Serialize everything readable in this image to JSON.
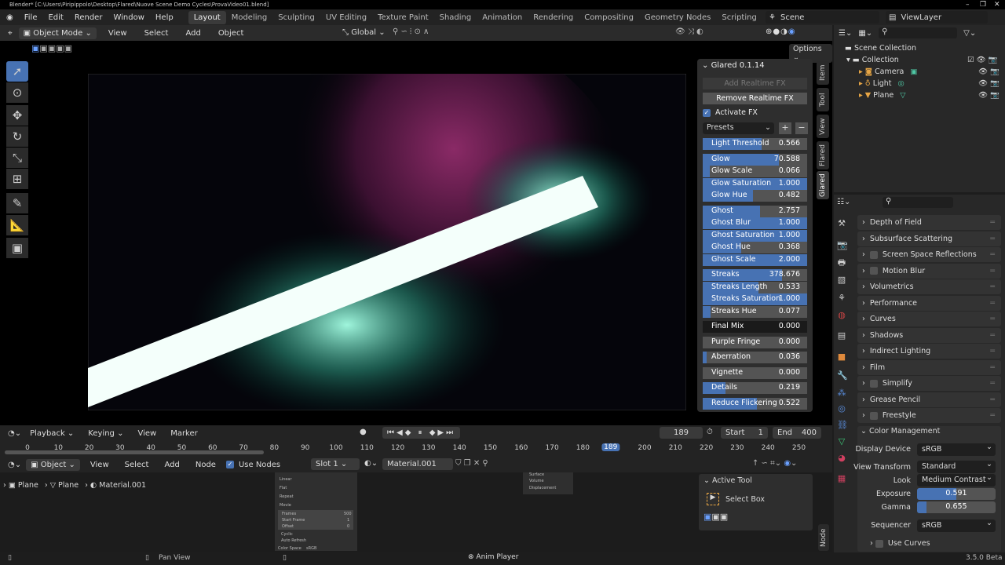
{
  "window": {
    "title": "Blender* [C:\\Users\\Piripippolo\\Desktop\\Flared\\Nuove Scene Demo Cycles\\ProvaVideo01.blend]",
    "controls": [
      "–",
      "❐",
      "✕"
    ]
  },
  "menu": [
    "File",
    "Edit",
    "Render",
    "Window",
    "Help"
  ],
  "workspaces": [
    {
      "label": "Layout",
      "active": true
    },
    {
      "label": "Modeling"
    },
    {
      "label": "Sculpting"
    },
    {
      "label": "UV Editing"
    },
    {
      "label": "Texture Paint"
    },
    {
      "label": "Shading"
    },
    {
      "label": "Animation"
    },
    {
      "label": "Rendering"
    },
    {
      "label": "Compositing"
    },
    {
      "label": "Geometry Nodes"
    },
    {
      "label": "Scripting"
    }
  ],
  "add_workspace": "+",
  "scene": {
    "label": "Scene",
    "view_layer": "ViewLayer"
  },
  "viewport_header": {
    "mode": "Object Mode",
    "menus": [
      "View",
      "Select",
      "Add",
      "Object"
    ],
    "orientation": "Global",
    "options": "Options"
  },
  "toolbar": {
    "icons": [
      "select-box-icon",
      "cursor-icon",
      "move-icon",
      "rotate-icon",
      "scale-icon",
      "transform-icon",
      "annotate-icon",
      "measure-icon",
      "add-cube-icon"
    ],
    "glyphs": [
      "➚",
      "⊙",
      "✥",
      "↻",
      "⤡",
      "⊞",
      "✎",
      "📐",
      "▣"
    ]
  },
  "glared": {
    "title": "Glared 0.1.14",
    "add_fx": "Add Realtime FX",
    "remove_fx": "Remove Realtime FX",
    "activate_fx": "Activate FX",
    "activate_checked": true,
    "presets": "Presets",
    "preset_add": "+",
    "preset_remove": "−",
    "sliders": [
      {
        "label": "Light Threshold",
        "value": "0.566",
        "fill": 0.566,
        "group": 0
      },
      {
        "label": "Glow",
        "value": "70.588",
        "fill": 0.73,
        "group": 1
      },
      {
        "label": "Glow Scale",
        "value": "0.066",
        "fill": 0.066,
        "group": 1
      },
      {
        "label": "Glow Saturation",
        "value": "1.000",
        "fill": 1,
        "group": 1
      },
      {
        "label": "Glow Hue",
        "value": "0.482",
        "fill": 0.482,
        "group": 1
      },
      {
        "label": "Ghost",
        "value": "2.757",
        "fill": 0.55,
        "group": 2
      },
      {
        "label": "Ghost Blur",
        "value": "1.000",
        "fill": 1,
        "group": 2
      },
      {
        "label": "Ghost Saturation",
        "value": "1.000",
        "fill": 1,
        "group": 2
      },
      {
        "label": "Ghost Hue",
        "value": "0.368",
        "fill": 0.368,
        "group": 2
      },
      {
        "label": "Ghost Scale",
        "value": "2.000",
        "fill": 1,
        "group": 2
      },
      {
        "label": "Streaks",
        "value": "378.676",
        "fill": 0.757,
        "group": 3
      },
      {
        "label": "Streaks Length",
        "value": "0.533",
        "fill": 0.533,
        "group": 3
      },
      {
        "label": "Streaks Saturation",
        "value": "1.000",
        "fill": 1,
        "group": 3
      },
      {
        "label": "Streaks Hue",
        "value": "0.077",
        "fill": 0.077,
        "group": 3
      },
      {
        "label": "Final Mix",
        "value": "0.000",
        "fill": 0,
        "group": 4,
        "dark": true
      },
      {
        "label": "Purple Fringe",
        "value": "0.000",
        "fill": 0,
        "group": 5
      },
      {
        "label": "Aberration",
        "value": "0.036",
        "fill": 0.036,
        "group": 6
      },
      {
        "label": "Vignette",
        "value": "0.000",
        "fill": 0,
        "group": 7
      },
      {
        "label": "Details",
        "value": "0.219",
        "fill": 0.219,
        "group": 8
      },
      {
        "label": "Reduce Flickering",
        "value": "0.522",
        "fill": 0.522,
        "group": 9
      }
    ],
    "tabs": [
      "Item",
      "Tool",
      "View",
      "Flared",
      "Glared"
    ]
  },
  "outliner": {
    "root": "Scene Collection",
    "collection": "Collection",
    "objects": [
      "Camera",
      "Light",
      "Plane"
    ]
  },
  "properties": {
    "panels": [
      {
        "label": "Depth of Field"
      },
      {
        "label": "Subsurface Scattering"
      },
      {
        "label": "Screen Space Reflections",
        "checkbox": true
      },
      {
        "label": "Motion Blur",
        "checkbox": true
      },
      {
        "label": "Volumetrics"
      },
      {
        "label": "Performance"
      },
      {
        "label": "Curves"
      },
      {
        "label": "Shadows"
      },
      {
        "label": "Indirect Lighting"
      },
      {
        "label": "Film"
      },
      {
        "label": "Simplify",
        "checkbox": true
      },
      {
        "label": "Grease Pencil"
      },
      {
        "label": "Freestyle",
        "checkbox": true
      }
    ],
    "color_management": {
      "title": "Color Management",
      "display_device_label": "Display Device",
      "display_device": "sRGB",
      "view_transform_label": "View Transform",
      "view_transform": "Standard",
      "look_label": "Look",
      "look": "Medium Contrast",
      "exposure_label": "Exposure",
      "exposure": "0.591",
      "exposure_fill": 0.5,
      "gamma_label": "Gamma",
      "gamma": "0.655",
      "gamma_fill": 0.12,
      "sequencer_label": "Sequencer",
      "sequencer": "sRGB",
      "use_curves": "Use Curves"
    },
    "tab_icons": [
      "tool-icon",
      "render-icon",
      "output-icon",
      "view-layer-icon",
      "scene-icon",
      "world-icon",
      "collection-icon",
      "object-icon",
      "modifier-icon",
      "particles-icon",
      "physics-icon",
      "constraints-icon",
      "data-icon",
      "material-icon",
      "texture-icon"
    ]
  },
  "timeline": {
    "menus": [
      "Playback",
      "Keying",
      "View",
      "Marker"
    ],
    "current_frame": "189",
    "start_label": "Start",
    "start": "1",
    "end_label": "End",
    "end": "400",
    "ticks": [
      0,
      10,
      20,
      30,
      40,
      50,
      60,
      70,
      80,
      90,
      100,
      110,
      120,
      130,
      140,
      150,
      160,
      170,
      180,
      189,
      200,
      210,
      220,
      230,
      240,
      250
    ]
  },
  "node_editor": {
    "type": "Object",
    "menus": [
      "View",
      "Select",
      "Add",
      "Node"
    ],
    "use_nodes": "Use Nodes",
    "slot": "Slot 1",
    "material": "Material.001",
    "breadcrumb": [
      "Plane",
      "Plane",
      "Material.001"
    ],
    "image_node": {
      "rows": [
        "Linear",
        "Flat",
        "Repeat",
        "Movie"
      ],
      "frames_label": "Frames",
      "frames": "500",
      "start_frame_label": "Start Frame",
      "start_frame": "1",
      "offset_label": "Offset",
      "offset": "0",
      "cyclic": "Cyclic",
      "auto_refresh": "Auto Refresh",
      "color_space_label": "Color Space",
      "color_space": "sRGB"
    },
    "output_node": [
      "Surface",
      "Volume",
      "Displacement"
    ],
    "active_tool": {
      "title": "Active Tool",
      "tool": "Select Box"
    },
    "side_tabs": [
      "Node"
    ]
  },
  "status": {
    "pan_view": "Pan View",
    "anim_player": "Anim Player",
    "version": "3.5.0 Beta"
  },
  "colors": {
    "accent": "#4772b3",
    "background": "#1d1d1d",
    "panel": "#2e2e2e"
  }
}
